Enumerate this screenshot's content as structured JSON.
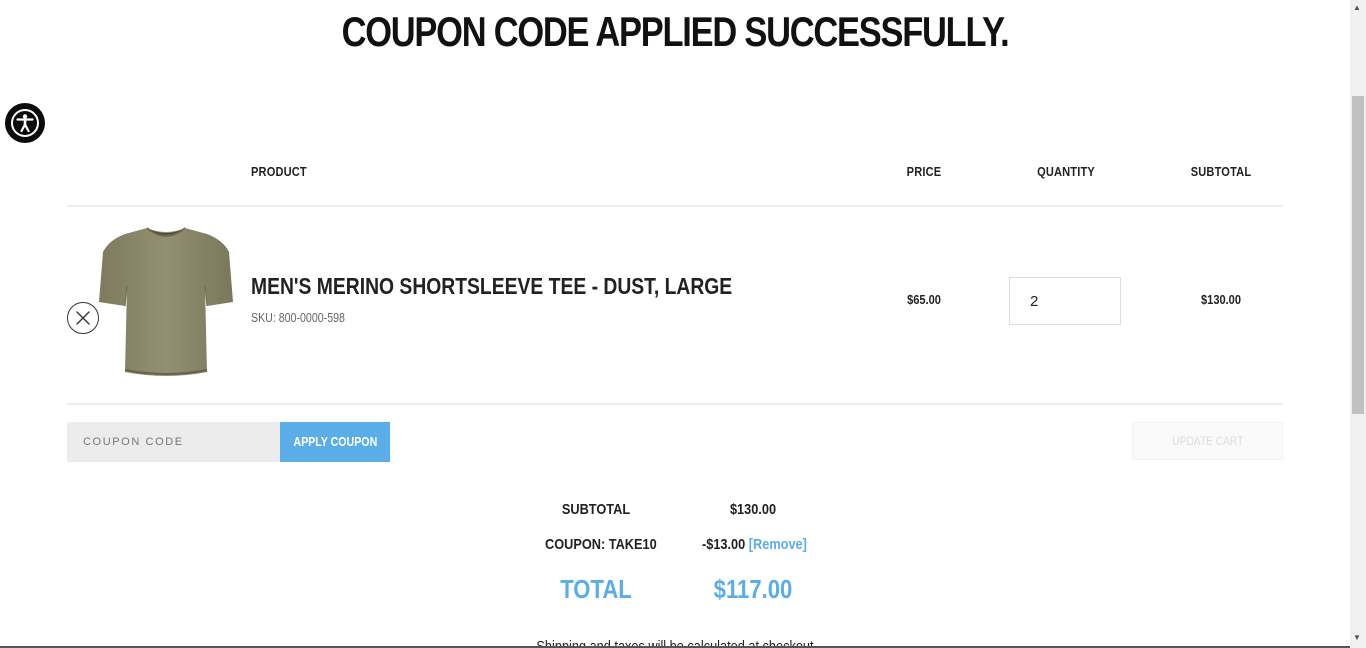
{
  "page": {
    "title": "COUPON CODE APPLIED SUCCESSFULLY."
  },
  "accessibility": {
    "icon": "accessibility-icon"
  },
  "table": {
    "headers": {
      "product": "PRODUCT",
      "price": "PRICE",
      "quantity": "QUANTITY",
      "subtotal": "SUBTOTAL"
    },
    "items": [
      {
        "name": "MEN'S MERINO SHORTSLEEVE TEE - DUST, LARGE",
        "sku": "SKU: 800-0000-598",
        "price": "$65.00",
        "quantity": "2",
        "subtotal": "$130.00",
        "image": "olive-tshirt",
        "remove_icon": "close-icon"
      }
    ]
  },
  "coupon": {
    "placeholder": "COUPON CODE",
    "apply_label": "APPLY COUPON"
  },
  "update_cart_label": "UPDATE CART",
  "totals": {
    "subtotal_label": "SUBTOTAL",
    "subtotal_value": "$130.00",
    "coupon_label": "COUPON: TAKE10",
    "coupon_value": "-$13.00",
    "coupon_remove": "[Remove]",
    "total_label": "TOTAL",
    "total_value": "$117.00"
  },
  "shipping_note": "Shipping and taxes will be calculated at checkout",
  "colors": {
    "accent": "#5aade6",
    "text": "#222222",
    "input_bg": "#ececec"
  }
}
